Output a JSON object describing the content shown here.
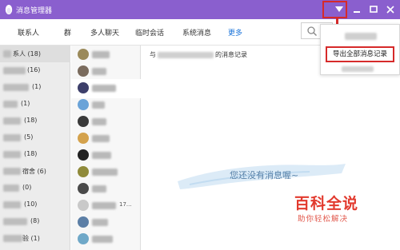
{
  "window": {
    "title": "消息管理器"
  },
  "tabs": [
    {
      "label": "联系人",
      "active": false
    },
    {
      "label": "群",
      "active": false
    },
    {
      "label": "多人聊天",
      "active": false
    },
    {
      "label": "临时会话",
      "active": false
    },
    {
      "label": "系统消息",
      "active": false
    },
    {
      "label": "更多",
      "active": true
    }
  ],
  "groups": [
    {
      "label": "系人",
      "count": "(18)"
    },
    {
      "label": "",
      "count": "(16)"
    },
    {
      "label": "",
      "count": "(1)"
    },
    {
      "label": "",
      "count": "(1)"
    },
    {
      "label": "",
      "count": "(18)"
    },
    {
      "label": "",
      "count": "(5)"
    },
    {
      "label": "",
      "count": "(18)"
    },
    {
      "label": "宿舍",
      "count": "(6)"
    },
    {
      "label": "",
      "count": "(0)"
    },
    {
      "label": "",
      "count": "(10)"
    },
    {
      "label": "",
      "count": "(8)"
    },
    {
      "label": "验",
      "count": "(1)"
    }
  ],
  "contacts_extra": "17...",
  "main": {
    "header_prefix": "与",
    "header_suffix": "的消息记录",
    "empty_text": "您还没有消息喔~"
  },
  "menu": {
    "export_all": "导出全部消息记录"
  },
  "watermark": {
    "title": "百科全说",
    "subtitle": "助你轻松解决"
  },
  "colors": {
    "titlebar": "#8a5fce",
    "accent": "#1a73d9",
    "highlight": "#d62a2a"
  },
  "icons": {
    "app": "penguin-icon",
    "dropdown": "triangle-down-icon",
    "minimize": "minimize-icon",
    "maximize": "maximize-icon",
    "close": "close-icon",
    "search": "search-icon"
  }
}
